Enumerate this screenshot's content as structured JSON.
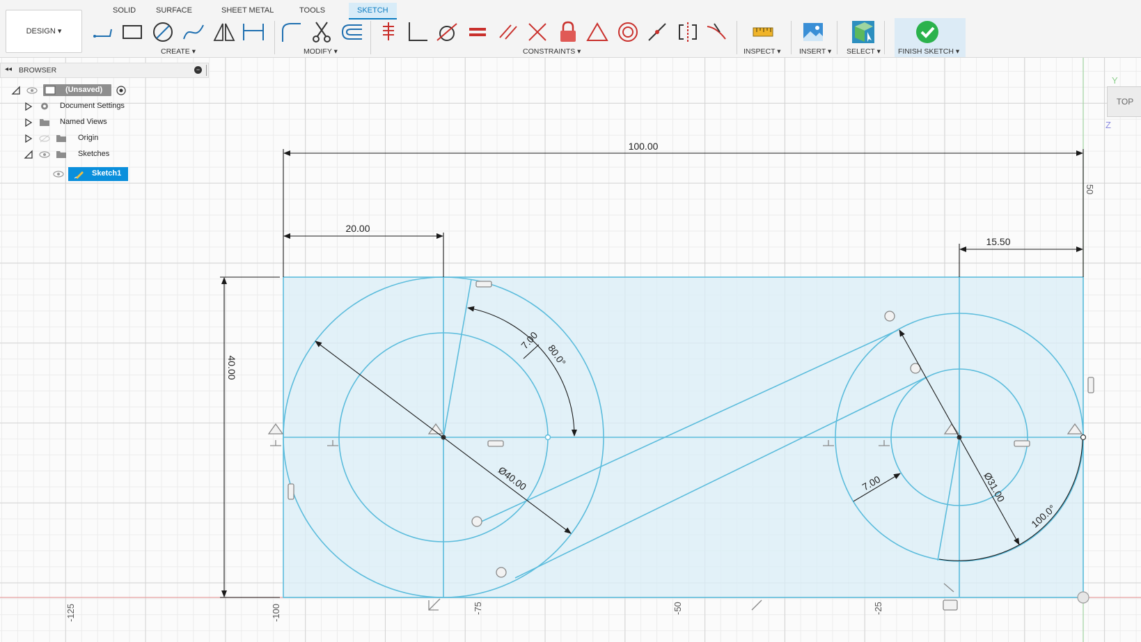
{
  "workspace": {
    "design_label": "DESIGN"
  },
  "tabs": [
    {
      "label": "SOLID",
      "active": false
    },
    {
      "label": "SURFACE",
      "active": false
    },
    {
      "label": "SHEET METAL",
      "active": false
    },
    {
      "label": "TOOLS",
      "active": false
    },
    {
      "label": "SKETCH",
      "active": true
    }
  ],
  "groups": {
    "create": "CREATE",
    "modify": "MODIFY",
    "constraints": "CONSTRAINTS",
    "inspect": "INSPECT",
    "insert": "INSERT",
    "select": "SELECT",
    "finish": "FINISH SKETCH"
  },
  "browser": {
    "title": "BROWSER",
    "root": "(Unsaved)",
    "items": [
      "Document Settings",
      "Named Views",
      "Origin",
      "Sketches"
    ],
    "sketch": "Sketch1"
  },
  "viewcube": {
    "face": "TOP",
    "axis_y": "Y",
    "axis_z": "Z"
  },
  "dimensions": {
    "overall_width": "100.00",
    "left_offset": "20.00",
    "right_offset": "15.50",
    "height": "40.00",
    "left_angle_len": "7.00",
    "left_angle": "80.0°",
    "left_diameter": "Ø40.00",
    "right_small_len": "7.00",
    "right_diameter": "Ø31.00",
    "right_angle": "100.0°",
    "top_side_value": "50"
  },
  "axis_ticks": [
    "-125",
    "-100",
    "-75",
    "-50",
    "-25"
  ],
  "colors": {
    "sketch_line": "#5bbcdc",
    "profile_fill": "#d9eef7",
    "dimension": "#1a1a1a",
    "selected": "#0a8fdc",
    "finish_green": "#2bb24c"
  }
}
